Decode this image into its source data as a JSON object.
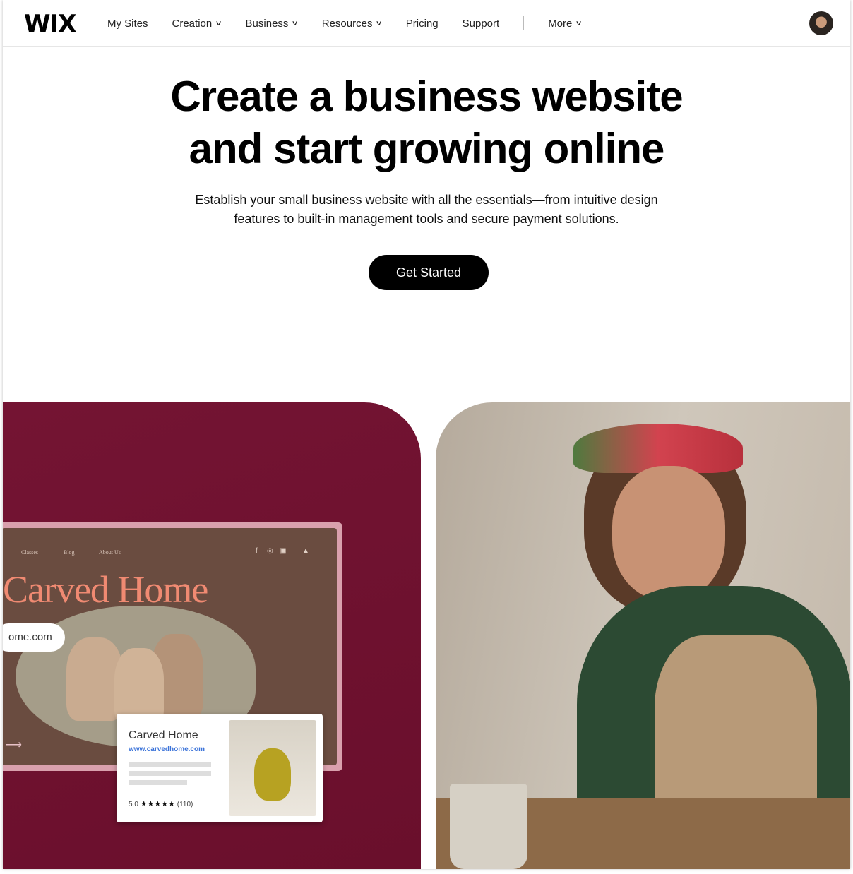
{
  "nav": {
    "logo": "WIX",
    "items": [
      {
        "label": "My Sites",
        "dropdown": false
      },
      {
        "label": "Creation",
        "dropdown": true
      },
      {
        "label": "Business",
        "dropdown": true
      },
      {
        "label": "Resources",
        "dropdown": true
      },
      {
        "label": "Pricing",
        "dropdown": false
      },
      {
        "label": "Support",
        "dropdown": false
      }
    ],
    "more": "More"
  },
  "hero": {
    "title_line1": "Create a business website",
    "title_line2": "and start growing online",
    "subtitle_line1": "Establish your small business website with all the essentials—from intuitive design",
    "subtitle_line2": "features to built-in management tools and secure payment solutions.",
    "cta": "Get Started"
  },
  "mockup": {
    "nav": [
      "Classes",
      "Blog",
      "About Us"
    ],
    "brand": "Carved Home",
    "domain": "ome.com",
    "card": {
      "title": "Carved Home",
      "url": "www.carvedhome.com",
      "rating": "5.0",
      "stars": 5,
      "reviews": "(110)"
    }
  },
  "colors": {
    "maroon": "#741433",
    "brand_coral": "#f08a72",
    "cta": "#000000",
    "link": "#3b73d9"
  }
}
